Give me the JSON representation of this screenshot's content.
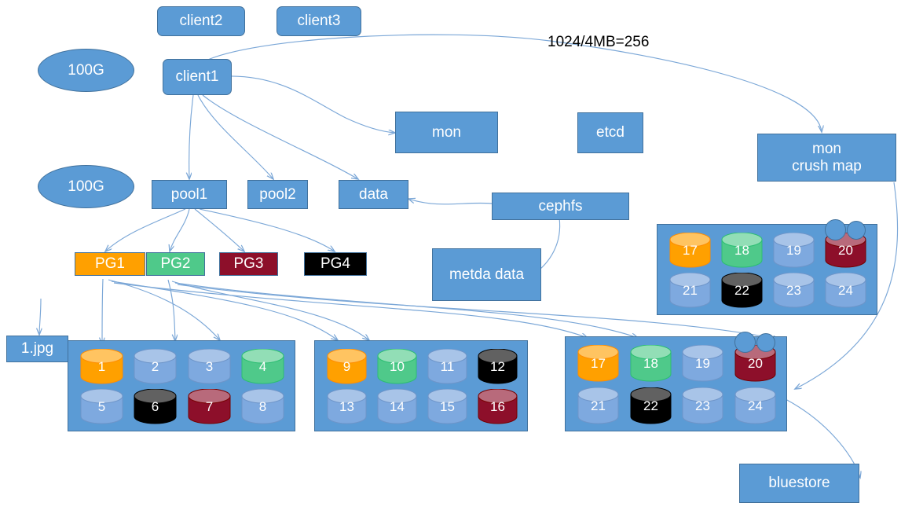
{
  "diagram": {
    "title": "Ceph storage architecture diagram",
    "colors": {
      "node_blue": "#5B9BD5",
      "node_border": "#41719C",
      "edge": "#7BA7D7",
      "pg1_orange": "#FFA000",
      "pg2_green": "#4FC98A",
      "pg3_darkred": "#8D0F2A",
      "pg4_black": "#000000",
      "disk_blue": "#6699DD",
      "text_white": "#FFFFFF",
      "text_black": "#000000"
    }
  },
  "nodes": {
    "client2": "client2",
    "client3": "client3",
    "client1": "client1",
    "size_top": "100G",
    "size_bottom": "100G",
    "mon": "mon",
    "etcd": "etcd",
    "mon_crush_map": "mon\ncrush map",
    "mon_crush_map_line1": "mon",
    "mon_crush_map_line2": "crush map",
    "pool1": "pool1",
    "pool2": "pool2",
    "data": "data",
    "cephfs": "cephfs",
    "metda_data": "metda data",
    "file": "1.jpg",
    "bluestore": "bluestore"
  },
  "labels": {
    "chunk_calc": "1024/4MB=256"
  },
  "placement_groups": [
    {
      "label": "PG1",
      "color": "#FFA000",
      "text": "#FFFFFF"
    },
    {
      "label": "PG2",
      "color": "#4FC98A",
      "text": "#FFFFFF"
    },
    {
      "label": "PG3",
      "color": "#8D0F2A",
      "text": "#FFFFFF"
    },
    {
      "label": "PG4",
      "color": "#000000",
      "text": "#FFFFFF"
    }
  ],
  "osd_groups": [
    {
      "name": "osd-group-upper-right",
      "disks": [
        {
          "id": "17",
          "color": "#FFA000"
        },
        {
          "id": "18",
          "color": "#4FC98A"
        },
        {
          "id": "19",
          "color": "#7EA9DF"
        },
        {
          "id": "20",
          "color": "#8D0F2A"
        },
        {
          "id": "21",
          "color": "#7EA9DF"
        },
        {
          "id": "22",
          "color": "#000000"
        },
        {
          "id": "23",
          "color": "#7EA9DF"
        },
        {
          "id": "24",
          "color": "#7EA9DF"
        }
      ],
      "has_bubbles": true
    },
    {
      "name": "osd-group-1",
      "disks": [
        {
          "id": "1",
          "color": "#FFA000"
        },
        {
          "id": "2",
          "color": "#7EA9DF"
        },
        {
          "id": "3",
          "color": "#7EA9DF"
        },
        {
          "id": "4",
          "color": "#4FC98A"
        },
        {
          "id": "5",
          "color": "#7EA9DF"
        },
        {
          "id": "6",
          "color": "#000000"
        },
        {
          "id": "7",
          "color": "#8D0F2A"
        },
        {
          "id": "8",
          "color": "#7EA9DF"
        }
      ],
      "has_bubbles": false
    },
    {
      "name": "osd-group-2",
      "disks": [
        {
          "id": "9",
          "color": "#FFA000"
        },
        {
          "id": "10",
          "color": "#4FC98A"
        },
        {
          "id": "11",
          "color": "#7EA9DF"
        },
        {
          "id": "12",
          "color": "#000000"
        },
        {
          "id": "13",
          "color": "#7EA9DF"
        },
        {
          "id": "14",
          "color": "#7EA9DF"
        },
        {
          "id": "15",
          "color": "#7EA9DF"
        },
        {
          "id": "16",
          "color": "#8D0F2A"
        }
      ],
      "has_bubbles": false
    },
    {
      "name": "osd-group-3",
      "disks": [
        {
          "id": "17",
          "color": "#FFA000"
        },
        {
          "id": "18",
          "color": "#4FC98A"
        },
        {
          "id": "19",
          "color": "#7EA9DF"
        },
        {
          "id": "20",
          "color": "#8D0F2A"
        },
        {
          "id": "21",
          "color": "#7EA9DF"
        },
        {
          "id": "22",
          "color": "#000000"
        },
        {
          "id": "23",
          "color": "#7EA9DF"
        },
        {
          "id": "24",
          "color": "#7EA9DF"
        }
      ],
      "has_bubbles": true
    }
  ]
}
